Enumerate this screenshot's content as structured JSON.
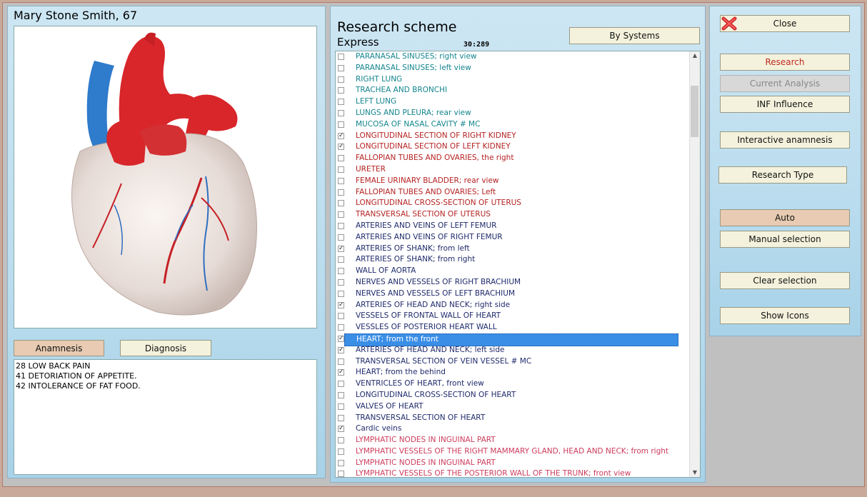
{
  "patient": {
    "name": "Mary Stone Smith, 67"
  },
  "left_buttons": {
    "anamnesis": "Anamnesis",
    "diagnosis": "Diagnosis"
  },
  "complaints": [
    "28 LOW BACK PAIN",
    "41 DETORIATION OF APPETITE.",
    "42 INTOLERANCE OF FAT FOOD."
  ],
  "scheme": {
    "title": "Research scheme",
    "subtitle": "Express",
    "time": "30:289",
    "by_systems": "By Systems"
  },
  "list": [
    {
      "label": "PARANASAL SINUSES; right view",
      "color": "#13858e",
      "checked": false
    },
    {
      "label": "PARANASAL SINUSES; left view",
      "color": "#13858e",
      "checked": false
    },
    {
      "label": "RIGHT LUNG",
      "color": "#13858e",
      "checked": false
    },
    {
      "label": "TRACHEA AND BRONCHI",
      "color": "#13858e",
      "checked": false
    },
    {
      "label": "LEFT LUNG",
      "color": "#13858e",
      "checked": false
    },
    {
      "label": "LUNGS AND PLEURA; rear view",
      "color": "#13858e",
      "checked": false
    },
    {
      "label": "MUCOSA OF NASAL CAVITY # MC",
      "color": "#13858e",
      "checked": false
    },
    {
      "label": "LONGITUDINAL SECTION OF RIGHT KIDNEY",
      "color": "#b52222",
      "checked": true
    },
    {
      "label": "LONGITUDINAL SECTION OF LEFT KIDNEY",
      "color": "#b52222",
      "checked": true
    },
    {
      "label": "FALLOPIAN TUBES AND OVARIES, the right",
      "color": "#b52222",
      "checked": false
    },
    {
      "label": "URETER",
      "color": "#b52222",
      "checked": false
    },
    {
      "label": "FEMALE URINARY BLADDER; rear view",
      "color": "#b52222",
      "checked": false
    },
    {
      "label": "FALLOPIAN TUBES AND OVARIES; Left",
      "color": "#b52222",
      "checked": false
    },
    {
      "label": "LONGITUDINAL CROSS-SECTION OF UTERUS",
      "color": "#b52222",
      "checked": false
    },
    {
      "label": "TRANSVERSAL SECTION OF UTERUS",
      "color": "#b52222",
      "checked": false
    },
    {
      "label": "ARTERIES AND VEINS OF LEFT FEMUR",
      "color": "#1f2a6b",
      "checked": false
    },
    {
      "label": "ARTERIES AND VEINS OF RIGHT FEMUR",
      "color": "#1f2a6b",
      "checked": false
    },
    {
      "label": "ARTERIES OF SHANK; from left",
      "color": "#1f2a6b",
      "checked": true
    },
    {
      "label": "ARTERIES OF SHANK; from right",
      "color": "#1f2a6b",
      "checked": false
    },
    {
      "label": "WALL OF AORTA",
      "color": "#1f2a6b",
      "checked": false
    },
    {
      "label": "NERVES AND VESSELS OF RIGHT BRACHIUM",
      "color": "#1f2a6b",
      "checked": false
    },
    {
      "label": "NERVES AND VESSELS OF LEFT BRACHIUM",
      "color": "#1f2a6b",
      "checked": false
    },
    {
      "label": "ARTERIES OF HEAD AND NECK; right side",
      "color": "#1f2a6b",
      "checked": true
    },
    {
      "label": "VESSELS OF FRONTAL WALL OF HEART",
      "color": "#1f2a6b",
      "checked": false
    },
    {
      "label": "VESSLES OF POSTERIOR HEART WALL",
      "color": "#1f2a6b",
      "checked": false
    },
    {
      "label": "HEART; from the front",
      "color": "#1f2a6b",
      "checked": true,
      "selected": true
    },
    {
      "label": "ARTERIES OF HEAD AND NECK; left side",
      "color": "#1f2a6b",
      "checked": true
    },
    {
      "label": "TRANSVERSAL SECTION OF VEIN VESSEL # MC",
      "color": "#1f2a6b",
      "checked": false
    },
    {
      "label": "HEART; from the behind",
      "color": "#1f2a6b",
      "checked": true
    },
    {
      "label": "VENTRICLES OF HEART, front view",
      "color": "#1f2a6b",
      "checked": false
    },
    {
      "label": "LONGITUDINAL CROSS-SECTION OF HEART",
      "color": "#1f2a6b",
      "checked": false
    },
    {
      "label": "VALVES OF HEART",
      "color": "#1f2a6b",
      "checked": false
    },
    {
      "label": "TRANSVERSAL SECTION OF HEART",
      "color": "#1f2a6b",
      "checked": false
    },
    {
      "label": "Cardic veins",
      "color": "#1f2a6b",
      "checked": true
    },
    {
      "label": "LYMPHATIC NODES IN INGUINAL PART",
      "color": "#cc3c5c",
      "checked": false
    },
    {
      "label": "LYMPHATIC VESSELS OF THE RIGHT MAMMARY GLAND, HEAD AND NECK; from right",
      "color": "#cc3c5c",
      "checked": false
    },
    {
      "label": "LYMPHATIC NODES IN INGUINAL PART",
      "color": "#cc3c5c",
      "checked": false
    },
    {
      "label": "LYMPHATIC VESSELS OF THE POSTERIOR WALL OF THE TRUNK; front view",
      "color": "#cc3c5c",
      "checked": false
    }
  ],
  "right_buttons": {
    "close": "Close",
    "research": "Research",
    "current_analysis": "Current Analysis",
    "inf_influence": "INF Influence",
    "interactive_anamnesis": "Interactive anamnesis",
    "research_type": "Research Type",
    "auto": "Auto",
    "manual_selection": "Manual selection",
    "clear_selection": "Clear selection",
    "show_icons": "Show Icons"
  }
}
